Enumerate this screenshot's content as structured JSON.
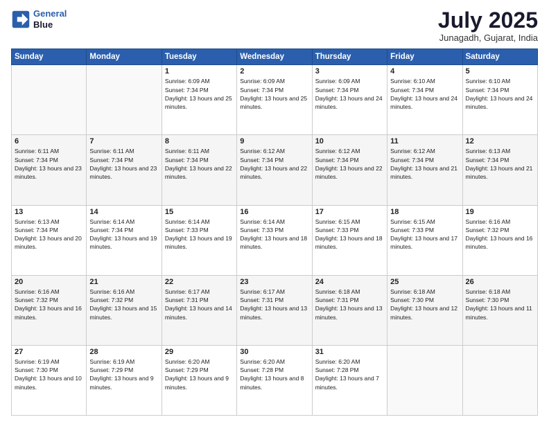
{
  "header": {
    "logo_line1": "General",
    "logo_line2": "Blue",
    "month": "July 2025",
    "location": "Junagadh, Gujarat, India"
  },
  "weekdays": [
    "Sunday",
    "Monday",
    "Tuesday",
    "Wednesday",
    "Thursday",
    "Friday",
    "Saturday"
  ],
  "weeks": [
    [
      {
        "day": "",
        "sunrise": "",
        "sunset": "",
        "daylight": ""
      },
      {
        "day": "",
        "sunrise": "",
        "sunset": "",
        "daylight": ""
      },
      {
        "day": "1",
        "sunrise": "Sunrise: 6:09 AM",
        "sunset": "Sunset: 7:34 PM",
        "daylight": "Daylight: 13 hours and 25 minutes."
      },
      {
        "day": "2",
        "sunrise": "Sunrise: 6:09 AM",
        "sunset": "Sunset: 7:34 PM",
        "daylight": "Daylight: 13 hours and 25 minutes."
      },
      {
        "day": "3",
        "sunrise": "Sunrise: 6:09 AM",
        "sunset": "Sunset: 7:34 PM",
        "daylight": "Daylight: 13 hours and 24 minutes."
      },
      {
        "day": "4",
        "sunrise": "Sunrise: 6:10 AM",
        "sunset": "Sunset: 7:34 PM",
        "daylight": "Daylight: 13 hours and 24 minutes."
      },
      {
        "day": "5",
        "sunrise": "Sunrise: 6:10 AM",
        "sunset": "Sunset: 7:34 PM",
        "daylight": "Daylight: 13 hours and 24 minutes."
      }
    ],
    [
      {
        "day": "6",
        "sunrise": "Sunrise: 6:11 AM",
        "sunset": "Sunset: 7:34 PM",
        "daylight": "Daylight: 13 hours and 23 minutes."
      },
      {
        "day": "7",
        "sunrise": "Sunrise: 6:11 AM",
        "sunset": "Sunset: 7:34 PM",
        "daylight": "Daylight: 13 hours and 23 minutes."
      },
      {
        "day": "8",
        "sunrise": "Sunrise: 6:11 AM",
        "sunset": "Sunset: 7:34 PM",
        "daylight": "Daylight: 13 hours and 22 minutes."
      },
      {
        "day": "9",
        "sunrise": "Sunrise: 6:12 AM",
        "sunset": "Sunset: 7:34 PM",
        "daylight": "Daylight: 13 hours and 22 minutes."
      },
      {
        "day": "10",
        "sunrise": "Sunrise: 6:12 AM",
        "sunset": "Sunset: 7:34 PM",
        "daylight": "Daylight: 13 hours and 22 minutes."
      },
      {
        "day": "11",
        "sunrise": "Sunrise: 6:12 AM",
        "sunset": "Sunset: 7:34 PM",
        "daylight": "Daylight: 13 hours and 21 minutes."
      },
      {
        "day": "12",
        "sunrise": "Sunrise: 6:13 AM",
        "sunset": "Sunset: 7:34 PM",
        "daylight": "Daylight: 13 hours and 21 minutes."
      }
    ],
    [
      {
        "day": "13",
        "sunrise": "Sunrise: 6:13 AM",
        "sunset": "Sunset: 7:34 PM",
        "daylight": "Daylight: 13 hours and 20 minutes."
      },
      {
        "day": "14",
        "sunrise": "Sunrise: 6:14 AM",
        "sunset": "Sunset: 7:34 PM",
        "daylight": "Daylight: 13 hours and 19 minutes."
      },
      {
        "day": "15",
        "sunrise": "Sunrise: 6:14 AM",
        "sunset": "Sunset: 7:33 PM",
        "daylight": "Daylight: 13 hours and 19 minutes."
      },
      {
        "day": "16",
        "sunrise": "Sunrise: 6:14 AM",
        "sunset": "Sunset: 7:33 PM",
        "daylight": "Daylight: 13 hours and 18 minutes."
      },
      {
        "day": "17",
        "sunrise": "Sunrise: 6:15 AM",
        "sunset": "Sunset: 7:33 PM",
        "daylight": "Daylight: 13 hours and 18 minutes."
      },
      {
        "day": "18",
        "sunrise": "Sunrise: 6:15 AM",
        "sunset": "Sunset: 7:33 PM",
        "daylight": "Daylight: 13 hours and 17 minutes."
      },
      {
        "day": "19",
        "sunrise": "Sunrise: 6:16 AM",
        "sunset": "Sunset: 7:32 PM",
        "daylight": "Daylight: 13 hours and 16 minutes."
      }
    ],
    [
      {
        "day": "20",
        "sunrise": "Sunrise: 6:16 AM",
        "sunset": "Sunset: 7:32 PM",
        "daylight": "Daylight: 13 hours and 16 minutes."
      },
      {
        "day": "21",
        "sunrise": "Sunrise: 6:16 AM",
        "sunset": "Sunset: 7:32 PM",
        "daylight": "Daylight: 13 hours and 15 minutes."
      },
      {
        "day": "22",
        "sunrise": "Sunrise: 6:17 AM",
        "sunset": "Sunset: 7:31 PM",
        "daylight": "Daylight: 13 hours and 14 minutes."
      },
      {
        "day": "23",
        "sunrise": "Sunrise: 6:17 AM",
        "sunset": "Sunset: 7:31 PM",
        "daylight": "Daylight: 13 hours and 13 minutes."
      },
      {
        "day": "24",
        "sunrise": "Sunrise: 6:18 AM",
        "sunset": "Sunset: 7:31 PM",
        "daylight": "Daylight: 13 hours and 13 minutes."
      },
      {
        "day": "25",
        "sunrise": "Sunrise: 6:18 AM",
        "sunset": "Sunset: 7:30 PM",
        "daylight": "Daylight: 13 hours and 12 minutes."
      },
      {
        "day": "26",
        "sunrise": "Sunrise: 6:18 AM",
        "sunset": "Sunset: 7:30 PM",
        "daylight": "Daylight: 13 hours and 11 minutes."
      }
    ],
    [
      {
        "day": "27",
        "sunrise": "Sunrise: 6:19 AM",
        "sunset": "Sunset: 7:30 PM",
        "daylight": "Daylight: 13 hours and 10 minutes."
      },
      {
        "day": "28",
        "sunrise": "Sunrise: 6:19 AM",
        "sunset": "Sunset: 7:29 PM",
        "daylight": "Daylight: 13 hours and 9 minutes."
      },
      {
        "day": "29",
        "sunrise": "Sunrise: 6:20 AM",
        "sunset": "Sunset: 7:29 PM",
        "daylight": "Daylight: 13 hours and 9 minutes."
      },
      {
        "day": "30",
        "sunrise": "Sunrise: 6:20 AM",
        "sunset": "Sunset: 7:28 PM",
        "daylight": "Daylight: 13 hours and 8 minutes."
      },
      {
        "day": "31",
        "sunrise": "Sunrise: 6:20 AM",
        "sunset": "Sunset: 7:28 PM",
        "daylight": "Daylight: 13 hours and 7 minutes."
      },
      {
        "day": "",
        "sunrise": "",
        "sunset": "",
        "daylight": ""
      },
      {
        "day": "",
        "sunrise": "",
        "sunset": "",
        "daylight": ""
      }
    ]
  ]
}
